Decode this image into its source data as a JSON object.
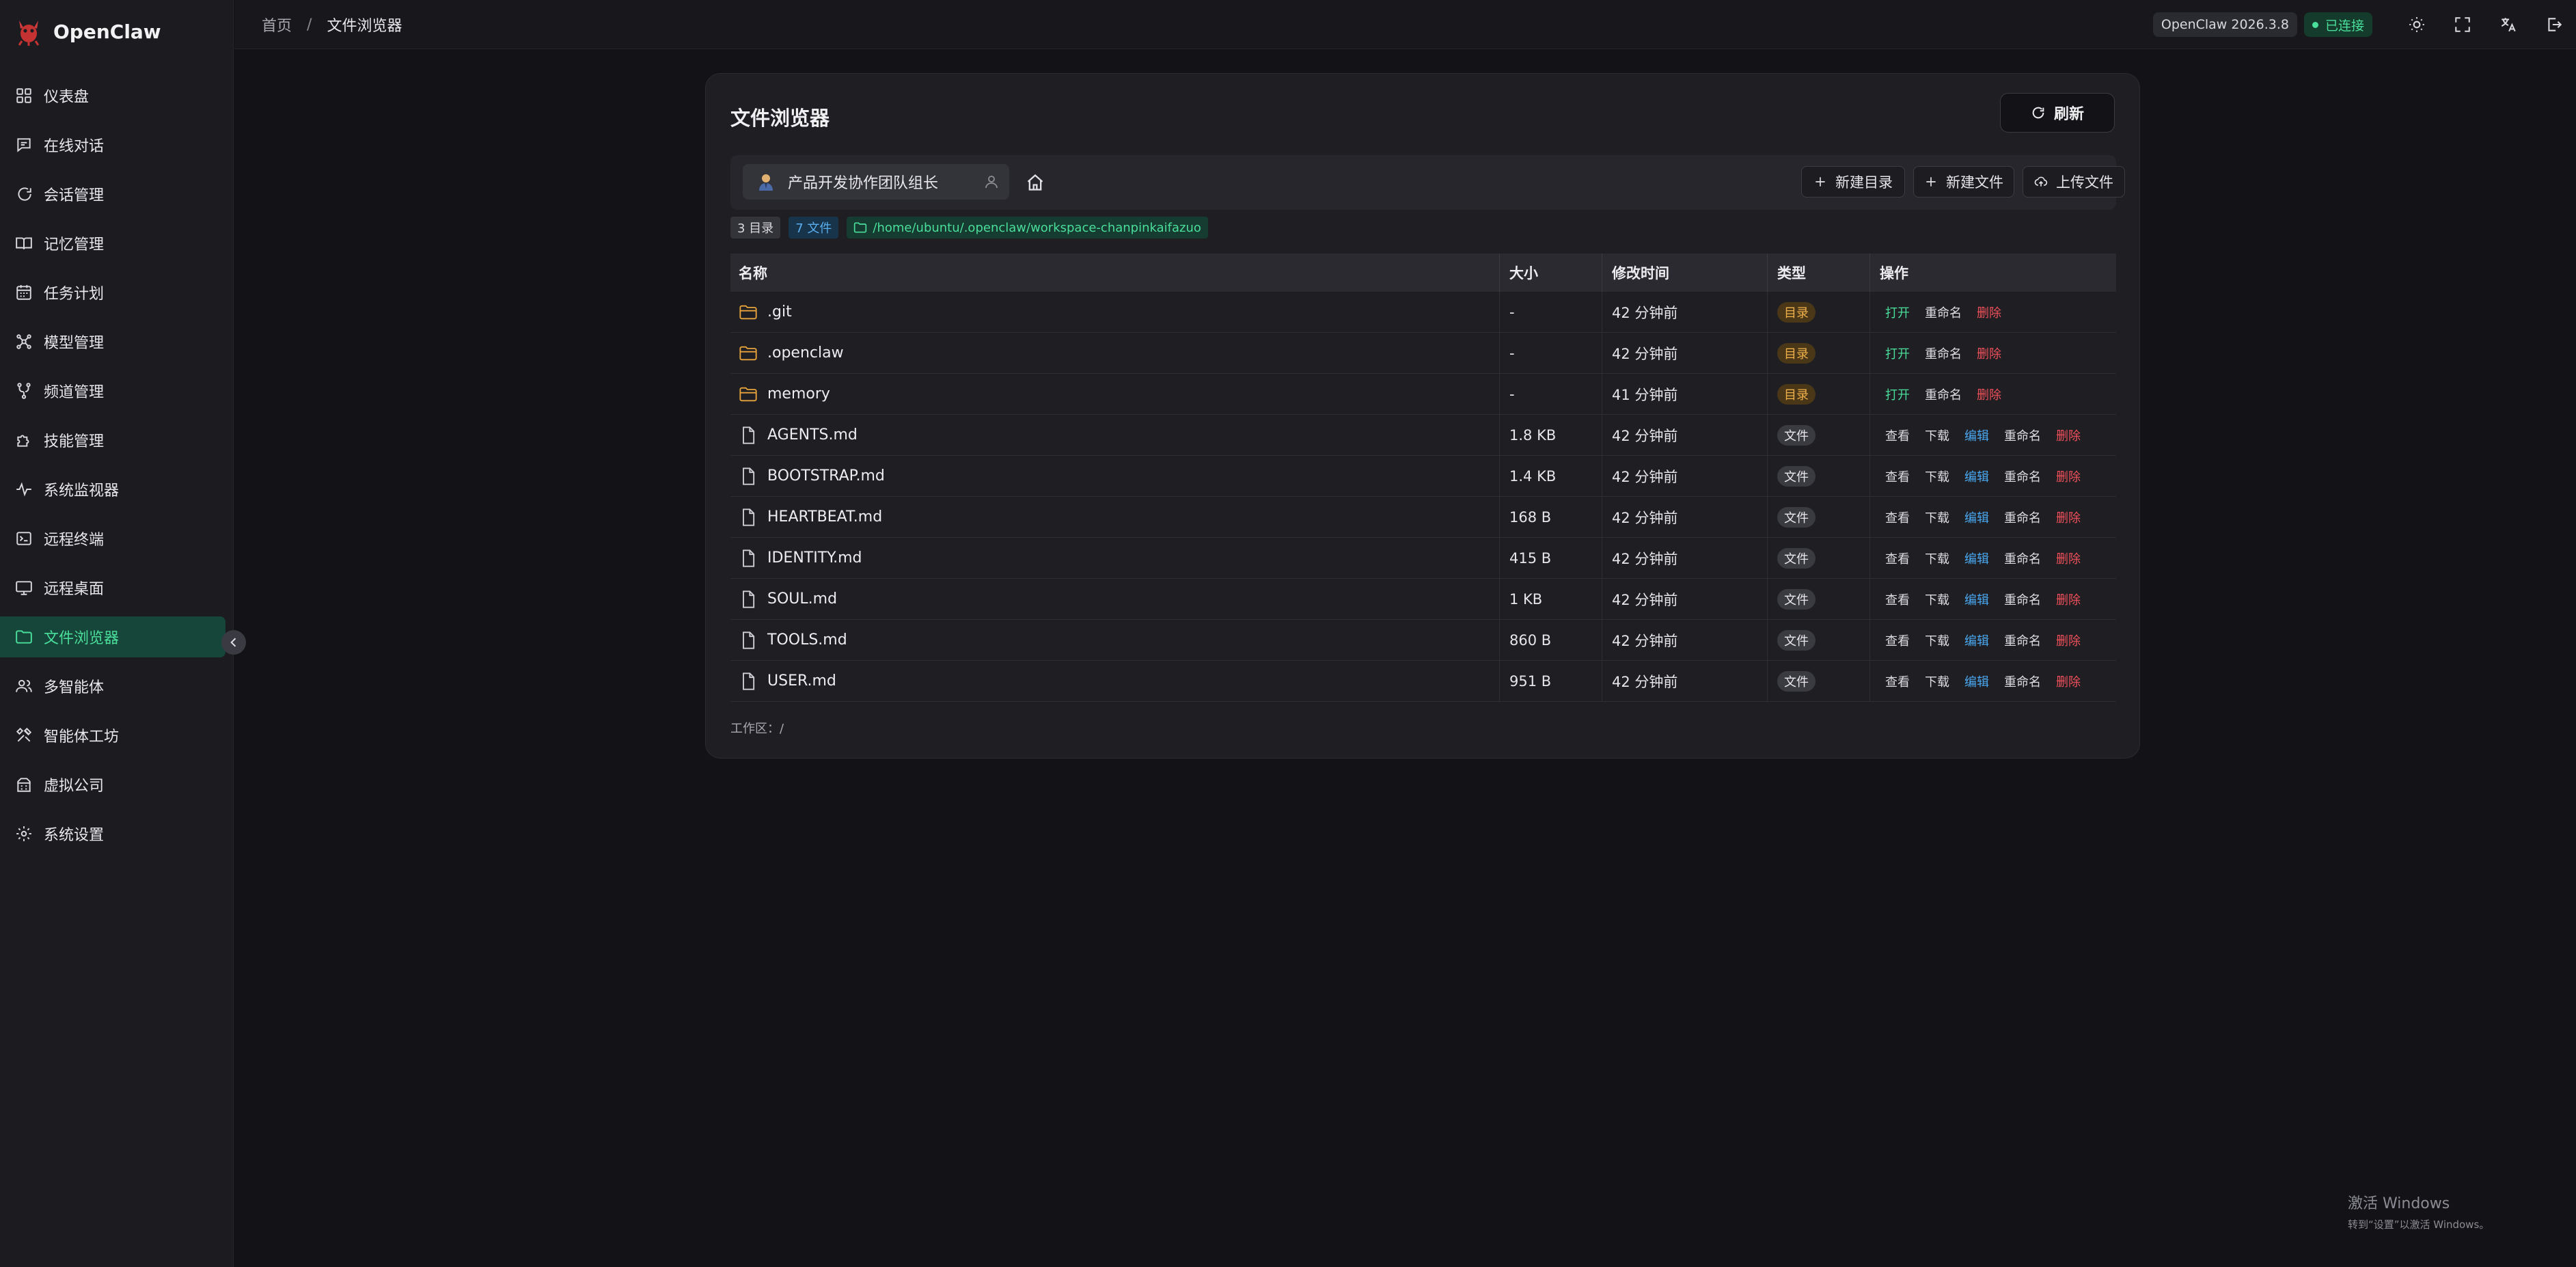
{
  "app": {
    "name": "OpenClaw"
  },
  "sidebar": {
    "items": [
      {
        "label": "仪表盘",
        "icon": "dashboard-icon",
        "active": false
      },
      {
        "label": "在线对话",
        "icon": "chat-icon",
        "active": false
      },
      {
        "label": "会话管理",
        "icon": "session-icon",
        "active": false
      },
      {
        "label": "记忆管理",
        "icon": "book-icon",
        "active": false
      },
      {
        "label": "任务计划",
        "icon": "calendar-icon",
        "active": false
      },
      {
        "label": "模型管理",
        "icon": "model-icon",
        "active": false
      },
      {
        "label": "频道管理",
        "icon": "channel-icon",
        "active": false
      },
      {
        "label": "技能管理",
        "icon": "puzzle-icon",
        "active": false
      },
      {
        "label": "系统监视器",
        "icon": "pulse-icon",
        "active": false
      },
      {
        "label": "远程终端",
        "icon": "terminal-icon",
        "active": false
      },
      {
        "label": "远程桌面",
        "icon": "monitor-icon",
        "active": false
      },
      {
        "label": "文件浏览器",
        "icon": "folder-icon",
        "active": true
      },
      {
        "label": "多智能体",
        "icon": "users-icon",
        "active": false
      },
      {
        "label": "智能体工坊",
        "icon": "tools-icon",
        "active": false
      },
      {
        "label": "虚拟公司",
        "icon": "building-icon",
        "active": false
      },
      {
        "label": "系统设置",
        "icon": "gear-icon",
        "active": false
      }
    ]
  },
  "topbar": {
    "breadcrumb_home": "首页",
    "breadcrumb_sep": "/",
    "breadcrumb_current": "文件浏览器",
    "version": "OpenClaw 2026.3.8",
    "status": "已连接"
  },
  "card": {
    "title": "文件浏览器",
    "refresh_label": "刷新",
    "agent_name": "产品开发协作团队组长",
    "mkdir_label": "新建目录",
    "mkfile_label": "新建文件",
    "upload_label": "上传文件",
    "dir_count": "3 目录",
    "file_count": "7 文件",
    "path": "/home/ubuntu/.openclaw/workspace-chanpinkaifazuo",
    "workspace": "工作区：/"
  },
  "table": {
    "headers": {
      "name": "名称",
      "size": "大小",
      "time": "修改时间",
      "type": "类型",
      "actions": "操作"
    },
    "rows": [
      {
        "name": ".git",
        "size": "-",
        "time": "42 分钟前",
        "type": "目录",
        "kind": "dir"
      },
      {
        "name": ".openclaw",
        "size": "-",
        "time": "42 分钟前",
        "type": "目录",
        "kind": "dir"
      },
      {
        "name": "memory",
        "size": "-",
        "time": "41 分钟前",
        "type": "目录",
        "kind": "dir"
      },
      {
        "name": "AGENTS.md",
        "size": "1.8 KB",
        "time": "42 分钟前",
        "type": "文件",
        "kind": "file"
      },
      {
        "name": "BOOTSTRAP.md",
        "size": "1.4 KB",
        "time": "42 分钟前",
        "type": "文件",
        "kind": "file"
      },
      {
        "name": "HEARTBEAT.md",
        "size": "168 B",
        "time": "42 分钟前",
        "type": "文件",
        "kind": "file"
      },
      {
        "name": "IDENTITY.md",
        "size": "415 B",
        "time": "42 分钟前",
        "type": "文件",
        "kind": "file"
      },
      {
        "name": "SOUL.md",
        "size": "1 KB",
        "time": "42 分钟前",
        "type": "文件",
        "kind": "file"
      },
      {
        "name": "TOOLS.md",
        "size": "860 B",
        "time": "42 分钟前",
        "type": "文件",
        "kind": "file"
      },
      {
        "name": "USER.md",
        "size": "951 B",
        "time": "42 分钟前",
        "type": "文件",
        "kind": "file"
      }
    ],
    "actions": {
      "open": "打开",
      "rename": "重命名",
      "delete": "删除",
      "view": "查看",
      "download": "下载",
      "edit": "编辑"
    }
  },
  "watermark": {
    "title": "激活 Windows",
    "subtitle": "转到“设置”以激活 Windows。"
  },
  "colors": {
    "accent": "#4ade9b",
    "danger": "#f0505a",
    "link": "#4aa8f0",
    "folder": "#e8a33c"
  }
}
